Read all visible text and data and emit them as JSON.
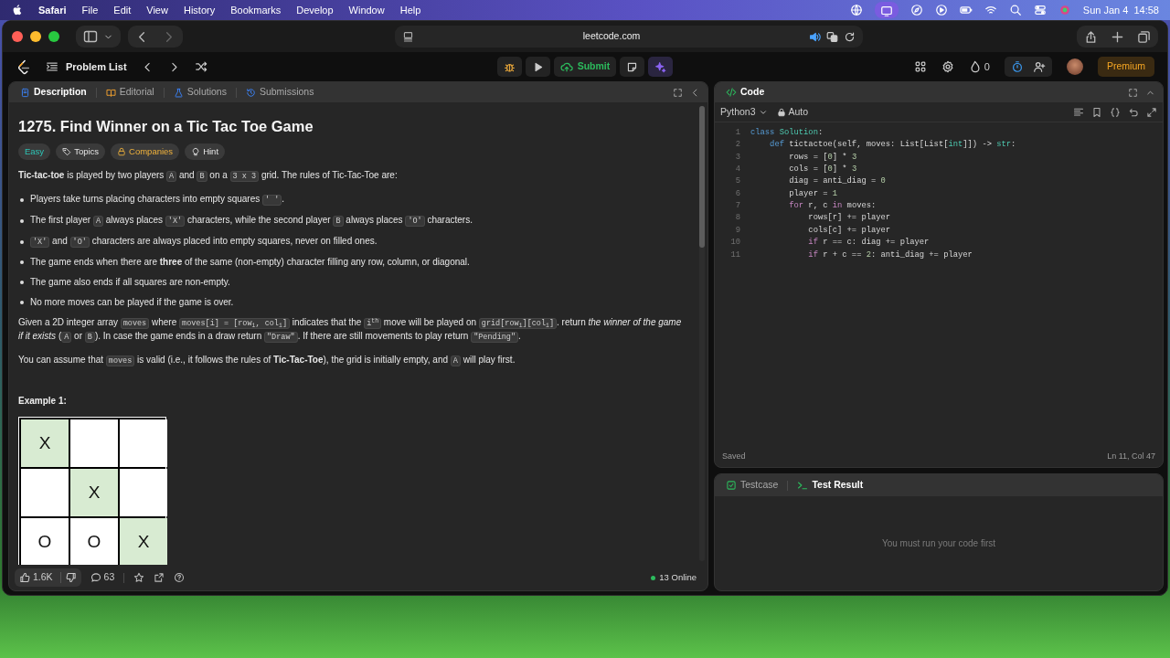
{
  "menubar": {
    "app": "Safari",
    "items": [
      "File",
      "Edit",
      "View",
      "History",
      "Bookmarks",
      "Develop",
      "Window",
      "Help"
    ],
    "clock": "Sun Jan 4  14:58"
  },
  "browser": {
    "url": "leetcode.com"
  },
  "nav": {
    "title": "Problem List",
    "submit": "Submit",
    "streak": "0",
    "premium": "Premium"
  },
  "description": {
    "tabs": [
      {
        "label": "Description",
        "selected": true
      },
      {
        "label": "Editorial",
        "selected": false
      },
      {
        "label": "Solutions",
        "selected": false
      },
      {
        "label": "Submissions",
        "selected": false
      }
    ],
    "title": "1275. Find Winner on a Tic Tac Toe Game",
    "tags": [
      {
        "label": "Easy",
        "kind": "difficulty"
      },
      {
        "label": "Topics",
        "kind": "topics"
      },
      {
        "label": "Companies",
        "kind": "companies"
      },
      {
        "label": "Hint",
        "kind": "hint"
      }
    ],
    "blocks": [
      {
        "kind": "paragraph",
        "parts": [
          {
            "kind": "text",
            "text": "**Tic-tac-toe** is played by two players "
          },
          {
            "kind": "code",
            "text": "A"
          },
          {
            "kind": "text",
            "text": " and "
          },
          {
            "kind": "code",
            "text": "B"
          },
          {
            "kind": "text",
            "text": " on a "
          },
          {
            "kind": "code",
            "text": "3 x 3"
          },
          {
            "kind": "text",
            "text": " grid. The rules of Tic-Tac-Toe are:"
          }
        ]
      },
      {
        "kind": "bullet",
        "parts": [
          {
            "kind": "text",
            "text": "Players take turns placing characters into empty squares "
          },
          {
            "kind": "code",
            "text": "' '"
          },
          {
            "kind": "text",
            "text": "."
          }
        ]
      },
      {
        "kind": "bullet",
        "parts": [
          {
            "kind": "text",
            "text": "The first player "
          },
          {
            "kind": "code",
            "text": "A"
          },
          {
            "kind": "text",
            "text": " always places "
          },
          {
            "kind": "code",
            "text": "'X'"
          },
          {
            "kind": "text",
            "text": " characters, while the second player "
          },
          {
            "kind": "code",
            "text": "B"
          },
          {
            "kind": "text",
            "text": " always places "
          },
          {
            "kind": "code",
            "text": "'O'"
          },
          {
            "kind": "text",
            "text": " characters."
          }
        ]
      },
      {
        "kind": "bullet",
        "parts": [
          {
            "kind": "code",
            "text": "'X'"
          },
          {
            "kind": "text",
            "text": " and "
          },
          {
            "kind": "code",
            "text": "'O'"
          },
          {
            "kind": "text",
            "text": " characters are always placed into empty squares, never on filled ones."
          }
        ]
      },
      {
        "kind": "bullet",
        "parts": [
          {
            "kind": "text",
            "text": "The game ends when there are **three** of the same (non-empty) character filling any row, column, or diagonal."
          }
        ]
      },
      {
        "kind": "bullet",
        "parts": [
          {
            "kind": "text",
            "text": "The game also ends if all squares are non-empty."
          }
        ]
      },
      {
        "kind": "bullet",
        "parts": [
          {
            "kind": "text",
            "text": "No more moves can be played if the game is over."
          }
        ]
      },
      {
        "kind": "paragraph",
        "parts": [
          {
            "kind": "text",
            "text": "Given a 2D integer array "
          },
          {
            "kind": "code",
            "text": "moves"
          },
          {
            "kind": "text",
            "text": " where "
          },
          {
            "kind": "code",
            "text": "moves[i] = [row$_{i}$, col$_{i}$]"
          },
          {
            "kind": "text",
            "text": " indicates that the "
          },
          {
            "kind": "code",
            "text": "i$^{th}$"
          },
          {
            "kind": "text",
            "text": " move will be played on "
          },
          {
            "kind": "code",
            "text": "grid[row$_{i}$][col$_{i}$]"
          },
          {
            "kind": "text",
            "text": ". return *the winner of the game if it exists* ("
          },
          {
            "kind": "code",
            "text": "A"
          },
          {
            "kind": "text",
            "text": " or "
          },
          {
            "kind": "code",
            "text": "B"
          },
          {
            "kind": "text",
            "text": "). In case the game ends in a draw return "
          },
          {
            "kind": "code",
            "text": "\"Draw\""
          },
          {
            "kind": "text",
            "text": ". If there are still movements to play return "
          },
          {
            "kind": "code",
            "text": "\"Pending\""
          },
          {
            "kind": "text",
            "text": "."
          }
        ]
      },
      {
        "kind": "paragraph",
        "parts": [
          {
            "kind": "text",
            "text": "You can assume that "
          },
          {
            "kind": "code",
            "text": "moves"
          },
          {
            "kind": "text",
            "text": " is valid (i.e., it follows the rules of **Tic-Tac-Toe**), the grid is initially empty, and "
          },
          {
            "kind": "code",
            "text": "A"
          },
          {
            "kind": "text",
            "text": " will play first."
          }
        ]
      }
    ],
    "example_title": "Example 1:",
    "board": [
      {
        "text": "X",
        "highlighted": true
      },
      {
        "highlighted": false
      },
      {
        "highlighted": false
      },
      {
        "highlighted": false
      },
      {
        "text": "X",
        "highlighted": true
      },
      {
        "highlighted": false
      },
      {
        "text": "O",
        "highlighted": false
      },
      {
        "text": "O",
        "highlighted": false
      },
      {
        "text": "X",
        "highlighted": true
      }
    ],
    "likes": "1.6K",
    "comments": "63",
    "online": "13 Online"
  },
  "code": {
    "title": "Code",
    "language": "Python3",
    "mode": "Auto",
    "lines": [
      {
        "number": "1",
        "tokens": [
          {
            "kind": "keyword",
            "text": "class "
          },
          {
            "kind": "type",
            "text": "Solution"
          },
          {
            "kind": "plain",
            "text": ":"
          }
        ]
      },
      {
        "number": "2",
        "tokens": [
          {
            "kind": "keyword",
            "text": "    def"
          },
          {
            "kind": "plain",
            "text": " tictactoe(self, moves: List[List["
          },
          {
            "kind": "type",
            "text": "int"
          },
          {
            "kind": "plain",
            "text": "]]) -> "
          },
          {
            "kind": "type",
            "text": "str"
          },
          {
            "kind": "plain",
            "text": ":"
          }
        ]
      },
      {
        "number": "3",
        "tokens": [
          {
            "kind": "plain",
            "text": "        rows = ["
          },
          {
            "kind": "number",
            "text": "0"
          },
          {
            "kind": "plain",
            "text": "] * "
          },
          {
            "kind": "number",
            "text": "3"
          }
        ]
      },
      {
        "number": "4",
        "tokens": [
          {
            "kind": "plain",
            "text": "        cols = ["
          },
          {
            "kind": "number",
            "text": "0"
          },
          {
            "kind": "plain",
            "text": "] * "
          },
          {
            "kind": "number",
            "text": "3"
          }
        ]
      },
      {
        "number": "5",
        "tokens": [
          {
            "kind": "plain",
            "text": "        diag = anti_diag = "
          },
          {
            "kind": "number",
            "text": "0"
          }
        ]
      },
      {
        "number": "6",
        "tokens": [
          {
            "kind": "plain",
            "text": "        player = "
          },
          {
            "kind": "number",
            "text": "1"
          }
        ]
      },
      {
        "number": "7",
        "tokens": [
          {
            "kind": "control",
            "text": "        for"
          },
          {
            "kind": "plain",
            "text": " r, c "
          },
          {
            "kind": "control",
            "text": "in"
          },
          {
            "kind": "plain",
            "text": " moves:"
          }
        ]
      },
      {
        "number": "8",
        "tokens": [
          {
            "kind": "plain",
            "text": "            rows[r] += player"
          }
        ]
      },
      {
        "number": "9",
        "tokens": [
          {
            "kind": "plain",
            "text": "            cols[c] += player"
          }
        ]
      },
      {
        "number": "10",
        "tokens": [
          {
            "kind": "control",
            "text": "            if"
          },
          {
            "kind": "plain",
            "text": " r == c: diag += player"
          }
        ]
      },
      {
        "number": "11",
        "tokens": [
          {
            "kind": "control",
            "text": "            if"
          },
          {
            "kind": "plain",
            "text": " r + c == "
          },
          {
            "kind": "number",
            "text": "2"
          },
          {
            "kind": "plain",
            "text": ": anti_diag += player"
          }
        ]
      }
    ],
    "status": "Saved",
    "cursor": "Ln 11, Col 47"
  },
  "test_panel": {
    "tabs": [
      {
        "label": "Testcase",
        "selected": false
      },
      {
        "label": "Test Result",
        "selected": true
      }
    ],
    "message": "You must run your code first"
  }
}
